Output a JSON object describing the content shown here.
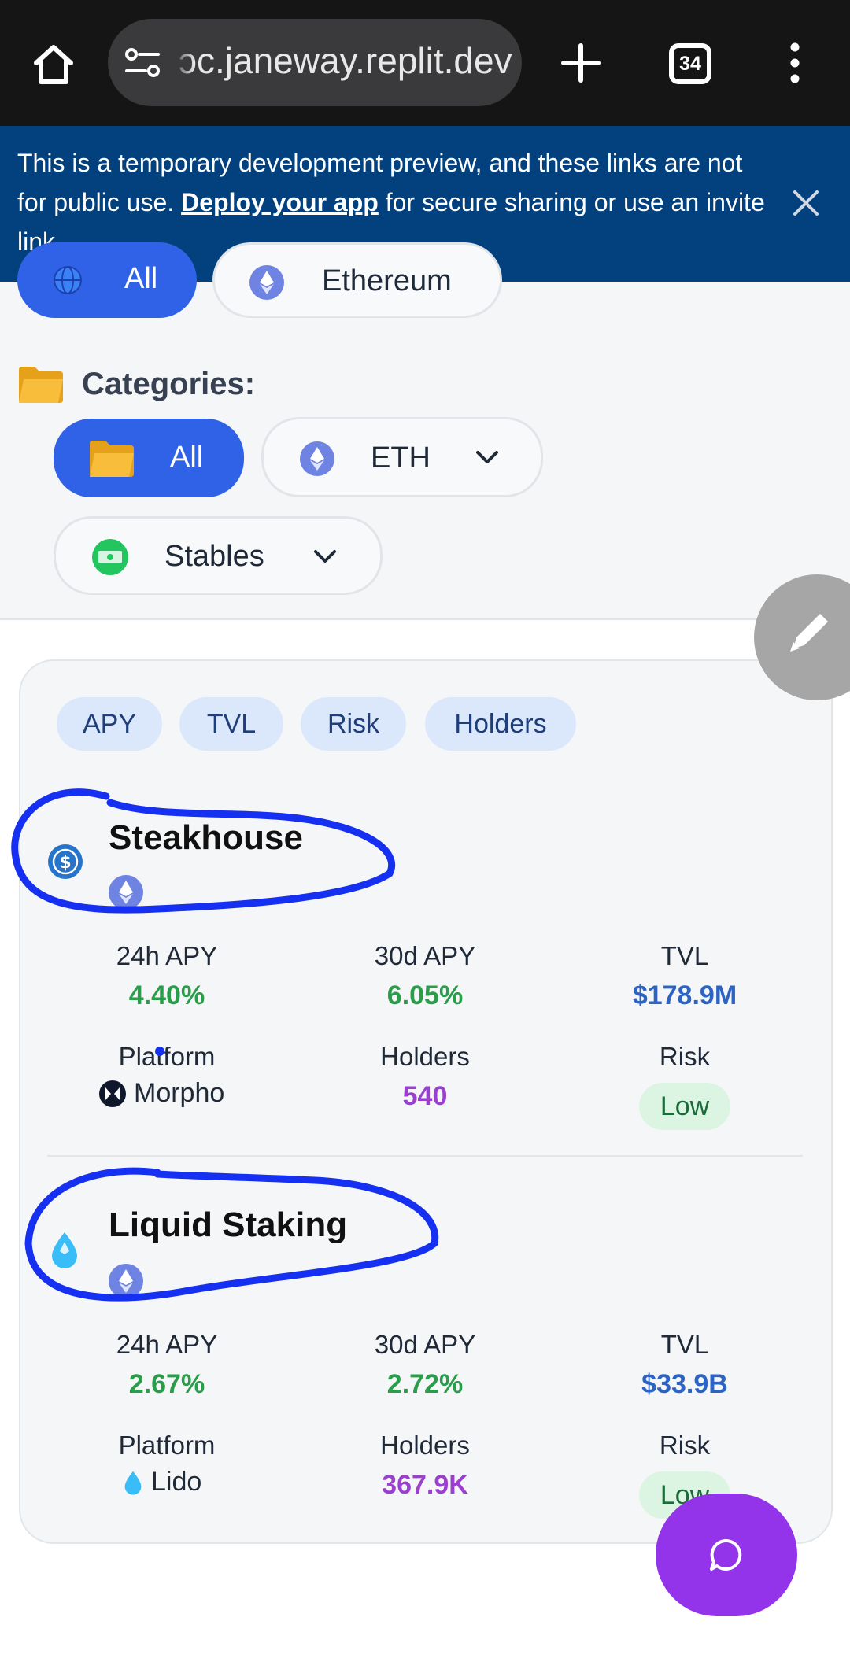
{
  "browser": {
    "url": "ɔc.janeway.replit.dev",
    "tab_count": "34"
  },
  "banner": {
    "text_before": "This is a temporary development preview, and these links are not for public use. ",
    "link": "Deploy your app",
    "text_after": " for secure sharing or use an invite link."
  },
  "networks": {
    "items": [
      {
        "label": "All",
        "icon": "globe-icon",
        "active": true
      },
      {
        "label": "Ethereum",
        "icon": "ethereum-icon",
        "active": false
      }
    ]
  },
  "categories": {
    "label": "Categories:",
    "items": [
      {
        "label": "All",
        "icon": "folder-icon",
        "active": true
      },
      {
        "label": "ETH",
        "icon": "ethereum-icon",
        "active": false
      },
      {
        "label": "Stables",
        "icon": "banknote-icon",
        "active": false
      }
    ]
  },
  "sort": {
    "options": [
      "APY",
      "TVL",
      "Risk",
      "Holders"
    ]
  },
  "pools": [
    {
      "name": "Steakhouse",
      "icon": "usdc-icon",
      "chain_icon": "ethereum-icon",
      "apy_24h_label": "24h APY",
      "apy_24h": "4.40%",
      "apy_30d_label": "30d APY",
      "apy_30d": "6.05%",
      "tvl_label": "TVL",
      "tvl": "$178.9M",
      "platform_label": "Platform",
      "platform": "Morpho",
      "platform_icon": "morpho-icon",
      "holders_label": "Holders",
      "holders": "540",
      "risk_label": "Risk",
      "risk": "Low"
    },
    {
      "name": "Liquid Staking",
      "icon": "lido-drop-icon",
      "chain_icon": "ethereum-icon",
      "apy_24h_label": "24h APY",
      "apy_24h": "2.67%",
      "apy_30d_label": "30d APY",
      "apy_30d": "2.72%",
      "tvl_label": "TVL",
      "tvl": "$33.9B",
      "platform_label": "Platform",
      "platform": "Lido",
      "platform_icon": "lido-drop-icon",
      "holders_label": "Holders",
      "holders": "367.9K",
      "risk_label": "Risk",
      "risk": "Low"
    }
  ],
  "colors": {
    "accent_blue": "#2f62e6",
    "banner_bg": "#02417d",
    "apy_green": "#2a9d4a",
    "tvl_blue": "#2d64c4",
    "holders_purple": "#9b3fd0",
    "chat_fab": "#9333ea",
    "annotation_scribble": "#1530f0"
  }
}
